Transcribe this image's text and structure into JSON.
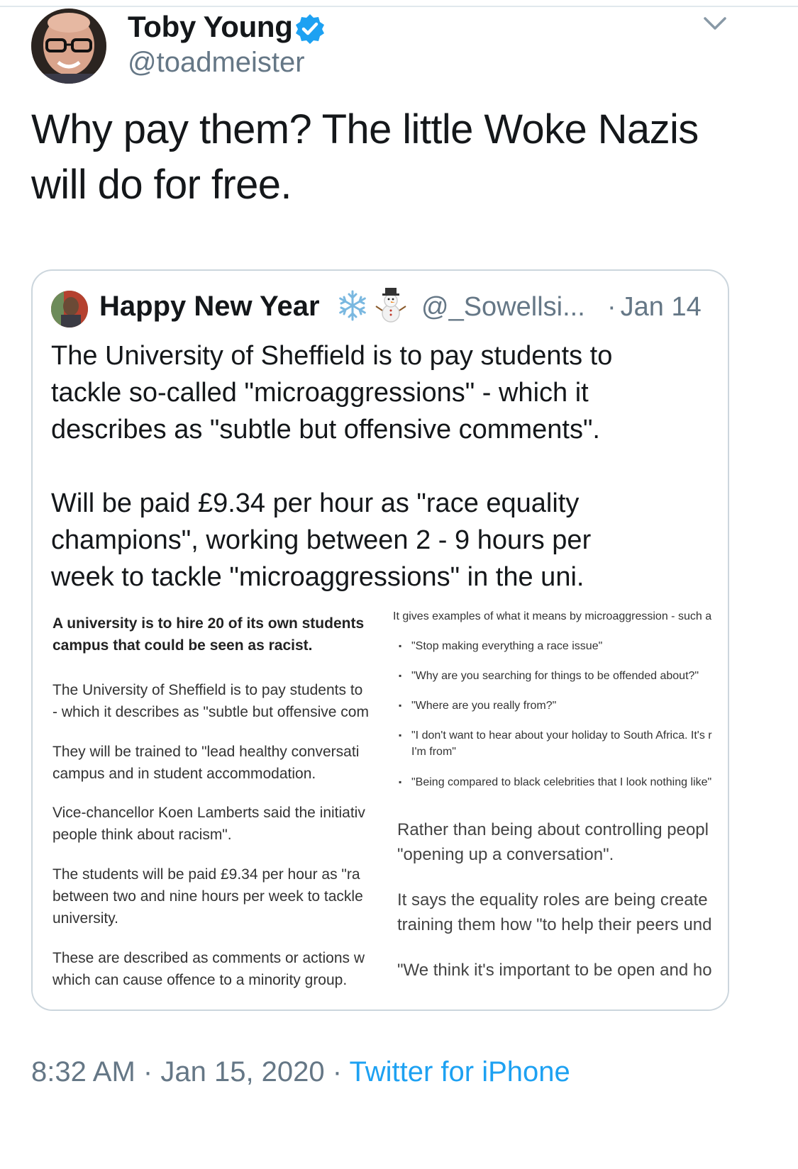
{
  "tweet": {
    "author_name": "Toby Young",
    "author_handle": "@toadmeister",
    "verified_icon": "verified-badge-icon",
    "text": "Why pay them? The little Woke Nazis\nwill do for free.",
    "time": "8:32 AM",
    "date": "Jan 15, 2020",
    "source": "Twitter for iPhone",
    "separator": "·"
  },
  "quoted_tweet": {
    "display_name": "Happy New Year",
    "emoji": [
      "snowflake-icon",
      "snowman-icon"
    ],
    "handle": "@_Sowellsi...",
    "date": "Jan 14",
    "text": "The University of Sheffield is to pay students to\ntackle so-called \"microaggressions\" - which it\ndescribes as \"subtle but offensive comments\".\n\nWill be paid £9.34 per hour as \"race equality\nchampions\", working between 2 - 9 hours per\nweek to tackle \"microaggressions\" in the uni."
  },
  "article_image": {
    "left": {
      "heading": [
        "A university is to hire 20 of its own students",
        "campus that could be seen as racist."
      ],
      "p1": [
        "The University of Sheffield is to pay students to",
        "- which it describes as \"subtle but offensive com"
      ],
      "p2": [
        "They will be trained to \"lead healthy conversati",
        "campus and in student accommodation."
      ],
      "p3": [
        "Vice-chancellor Koen Lamberts said the initiativ",
        "people think about racism\"."
      ],
      "p4": [
        "The students will be paid £9.34 per hour as \"ra",
        "between two and nine hours per week to tackle",
        "university."
      ],
      "p5": [
        "These are described as comments or actions w",
        "which can cause offence to a minority group."
      ]
    },
    "right": {
      "intro": "It gives examples of what it means by microaggression - such a",
      "bullets": [
        "\"Stop making everything a race issue\"",
        "\"Why are you searching for things to be offended about?\"",
        "\"Where are you really from?\"",
        "\"I don't want to hear about your holiday to South Africa. It's r",
        "I'm from\"",
        "\"Being compared to black celebrities that I look nothing like\""
      ],
      "p1": [
        "Rather than being about controlling peopl",
        "\"opening up a conversation\"."
      ],
      "p2": [
        "It says the equality roles are being create",
        "training them how \"to help their peers und"
      ],
      "p3": [
        "\"We think it's important to be open and ho"
      ]
    }
  }
}
